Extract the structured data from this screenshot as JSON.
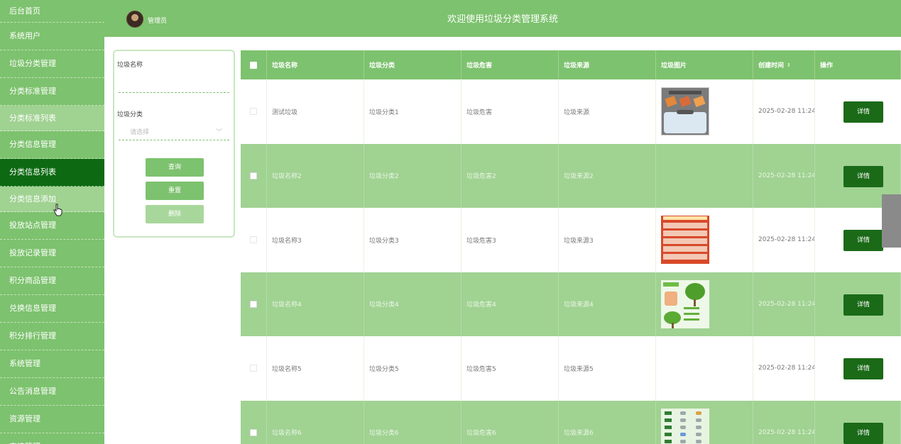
{
  "colors": {
    "primary": "#7dc26e",
    "sidebar_active": "#0e6a12",
    "row_alt": "#a0d292",
    "detail_button": "#1a6a18"
  },
  "sidebar": {
    "items": [
      {
        "label": "后台首页"
      },
      {
        "label": "系统用户"
      },
      {
        "label": "垃圾分类管理"
      },
      {
        "label": "分类标准管理"
      },
      {
        "label": "分类标准列表"
      },
      {
        "label": "分类信息管理"
      },
      {
        "label": "分类信息列表"
      },
      {
        "label": "分类信息添加"
      },
      {
        "label": "投放站点管理"
      },
      {
        "label": "投放记录管理"
      },
      {
        "label": "积分商品管理"
      },
      {
        "label": "兑换信息管理"
      },
      {
        "label": "积分排行管理"
      },
      {
        "label": "系统管理"
      },
      {
        "label": "公告消息管理"
      },
      {
        "label": "资源管理"
      },
      {
        "label": "交流管理"
      }
    ]
  },
  "header": {
    "title": "欢迎使用垃圾分类管理系统",
    "user": "管理员",
    "avatar_icon": "user-avatar-icon"
  },
  "filter": {
    "name_label": "垃圾名称",
    "name_value": "",
    "category_label": "垃圾分类",
    "category_placeholder": "请选择",
    "query_label": "查询",
    "reset_label": "重置",
    "delete_label": "删除"
  },
  "table": {
    "headers": [
      "垃圾名称",
      "垃圾分类",
      "垃圾危害",
      "垃圾来源",
      "垃圾图片",
      "创建时间",
      "操作"
    ],
    "sort_icon": "sort-icon",
    "detail_label": "详情",
    "rows": [
      {
        "name": "测试垃圾",
        "category": "垃圾分类1",
        "harm": "垃圾危害",
        "source": "垃圾来源",
        "time": "2025-02-28 11:24:",
        "image": "poster-gray"
      },
      {
        "name": "垃圾名称2",
        "category": "垃圾分类2",
        "harm": "垃圾危害2",
        "source": "垃圾来源2",
        "time": "2025-02-28 11:24:",
        "image": ""
      },
      {
        "name": "垃圾名称3",
        "category": "垃圾分类3",
        "harm": "垃圾危害3",
        "source": "垃圾来源3",
        "time": "2025-02-28 11:24:",
        "image": "poster-red"
      },
      {
        "name": "垃圾名称4",
        "category": "垃圾分类4",
        "harm": "垃圾危害4",
        "source": "垃圾来源4",
        "time": "2025-02-28 11:24:",
        "image": "poster-tree"
      },
      {
        "name": "垃圾名称5",
        "category": "垃圾分类5",
        "harm": "垃圾危害5",
        "source": "垃圾来源5",
        "time": "2025-02-28 11:24:",
        "image": ""
      },
      {
        "name": "垃圾名称6",
        "category": "垃圾分类6",
        "harm": "垃圾危害6",
        "source": "垃圾来源6",
        "time": "2025-02-28 11:24:",
        "image": "poster-green"
      }
    ]
  }
}
